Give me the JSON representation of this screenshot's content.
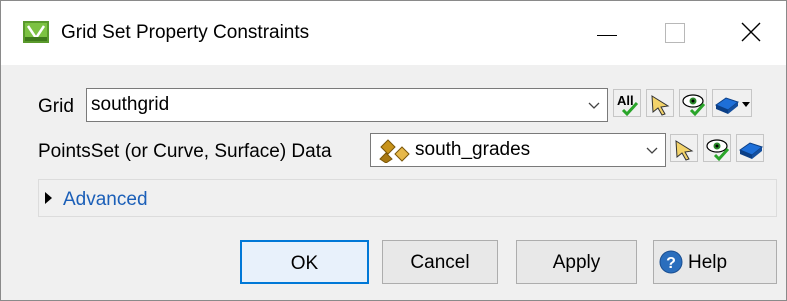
{
  "window": {
    "title": "Grid Set Property Constraints",
    "icon": "application-icon"
  },
  "grid_row": {
    "label": "Grid",
    "value": "southgrid",
    "buttons": [
      "all-icon",
      "select-pointer-icon",
      "visibility-eye-icon",
      "surface-icon"
    ]
  },
  "points_row": {
    "label": "PointsSet (or Curve, Surface) Data",
    "value": "south_grades",
    "value_icon": "pointset-icon",
    "buttons": [
      "select-pointer-icon",
      "visibility-eye-icon",
      "surface-icon"
    ]
  },
  "advanced": {
    "label": "Advanced"
  },
  "buttons": {
    "ok": "OK",
    "cancel": "Cancel",
    "apply": "Apply",
    "help": "Help"
  },
  "colors": {
    "accent": "#0078d7",
    "link": "#1b5fb8",
    "help_icon": "#2a6ebd"
  }
}
